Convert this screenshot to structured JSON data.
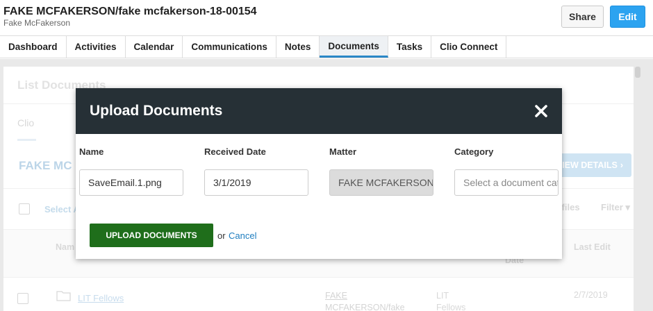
{
  "header": {
    "title": "FAKE MCFAKERSON/fake mcfakerson-18-00154",
    "subtitle": "Fake McFakerson",
    "share_label": "Share",
    "edit_label": "Edit"
  },
  "tabs": [
    {
      "label": "Dashboard",
      "active": false
    },
    {
      "label": "Activities",
      "active": false
    },
    {
      "label": "Calendar",
      "active": false
    },
    {
      "label": "Communications",
      "active": false
    },
    {
      "label": "Notes",
      "active": false
    },
    {
      "label": "Documents",
      "active": true
    },
    {
      "label": "Tasks",
      "active": false
    },
    {
      "label": "Clio Connect",
      "active": false
    }
  ],
  "background": {
    "section_title": "List Documents",
    "subtab": "Clio",
    "matter_heading": "FAKE MC",
    "view_details_label": "VIEW DETAILS",
    "select_all_label": "Select A",
    "files_label": "d files",
    "filter_label": "Filter",
    "columns": {
      "name": "Nam",
      "date": "Date",
      "last_edit": "Last Edit"
    },
    "rows": [
      {
        "name": "LIT Fellows",
        "matter": "FAKE MCFAKERSON/fake",
        "category": "LIT Fellows",
        "last_edit": "2/7/2019"
      }
    ]
  },
  "modal": {
    "title": "Upload Documents",
    "fields": {
      "name": {
        "label": "Name",
        "value": "SaveEmail.1.png"
      },
      "received_date": {
        "label": "Received Date",
        "value": "3/1/2019"
      },
      "matter": {
        "label": "Matter",
        "value": "FAKE MCFAKERSON"
      },
      "category": {
        "label": "Category",
        "placeholder": "Select a document category"
      }
    },
    "upload_label": "UPLOAD DOCUMENTS",
    "or_label": "or",
    "cancel_label": "Cancel"
  },
  "colors": {
    "accent": "#2ca3f0",
    "modal_header": "#263036",
    "upload_button": "#1f6e1b",
    "link": "#1e7dbf"
  }
}
